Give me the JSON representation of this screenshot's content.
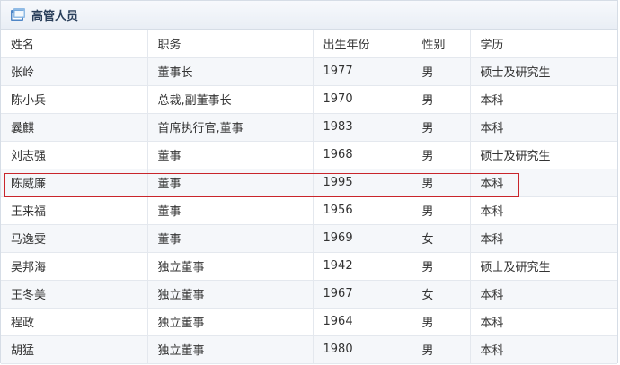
{
  "panel": {
    "title": "高管人员"
  },
  "table": {
    "headers": [
      "姓名",
      "职务",
      "出生年份",
      "性别",
      "学历"
    ],
    "rows": [
      [
        "张岭",
        "董事长",
        "1977",
        "男",
        "硕士及研究生"
      ],
      [
        "陈小兵",
        "总裁,副董事长",
        "1970",
        "男",
        "本科"
      ],
      [
        "曩麒",
        "首席执行官,董事",
        "1983",
        "男",
        "本科"
      ],
      [
        "刘志强",
        "董事",
        "1968",
        "男",
        "硕士及研究生"
      ],
      [
        "陈威廉",
        "董事",
        "1995",
        "男",
        "本科"
      ],
      [
        "王来福",
        "董事",
        "1956",
        "男",
        "本科"
      ],
      [
        "马逸雯",
        "董事",
        "1969",
        "女",
        "本科"
      ],
      [
        "吴邦海",
        "独立董事",
        "1942",
        "男",
        "硕士及研究生"
      ],
      [
        "王冬美",
        "独立董事",
        "1967",
        "女",
        "本科"
      ],
      [
        "程政",
        "独立董事",
        "1964",
        "男",
        "本科"
      ],
      [
        "胡猛",
        "独立董事",
        "1980",
        "男",
        "本科"
      ]
    ]
  },
  "colors": {
    "highlight_border": "#c9252b",
    "title_text": "#2a3f5a",
    "stripe": "#f5f7fa"
  },
  "icons": {
    "title": "window-icon"
  }
}
